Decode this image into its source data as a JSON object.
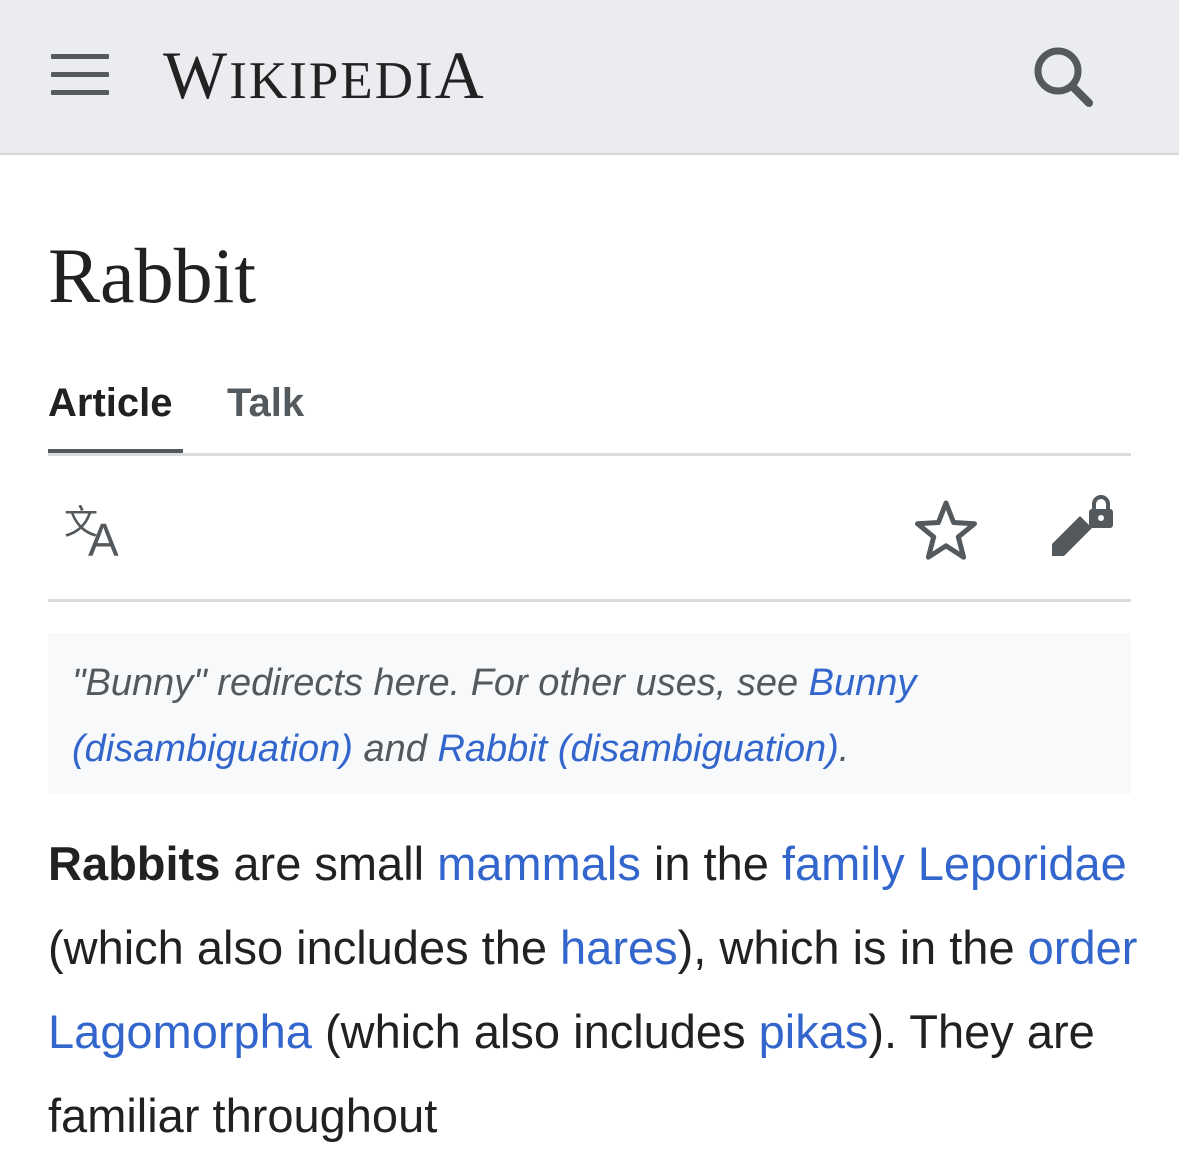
{
  "header": {
    "logo_first": "W",
    "logo_small": "IKIPEDI",
    "logo_last": "A",
    "menu_icon": "hamburger-menu-icon",
    "search_icon": "search-icon"
  },
  "article": {
    "title": "Rabbit"
  },
  "tabs": [
    {
      "label": "Article",
      "active": true
    },
    {
      "label": "Talk",
      "active": false
    }
  ],
  "toolbar": {
    "language_icon": "language-icon",
    "watch_icon": "star-icon",
    "edit_icon": "edit-locked-icon"
  },
  "hatnote": {
    "t1": "\"Bunny\" redirects here. For other uses, see ",
    "link1": "Bunny (disambiguation)",
    "t2": " and ",
    "link2": "Rabbit (disambiguation)",
    "t3": "."
  },
  "paragraph": {
    "bold_term": "Rabbits",
    "s1": " are small ",
    "l_mammals": "mammals",
    "s2": " in the ",
    "l_family": "family",
    "s3": " ",
    "l_leporidae": "Leporidae",
    "s4": " (which also includes the ",
    "l_hares": "hares",
    "s5": "), which is in the ",
    "l_order": "order",
    "s6": " ",
    "l_lagomorpha": "Lagomorpha",
    "s7": " (which also includes ",
    "l_pikas": "pikas",
    "s8": "). They are familiar throughout"
  },
  "colors": {
    "header_bg": "#eaecf0",
    "link": "#3366cc",
    "text": "#202122",
    "icon": "#54595d",
    "hatnote_bg": "#f8f9fa"
  }
}
